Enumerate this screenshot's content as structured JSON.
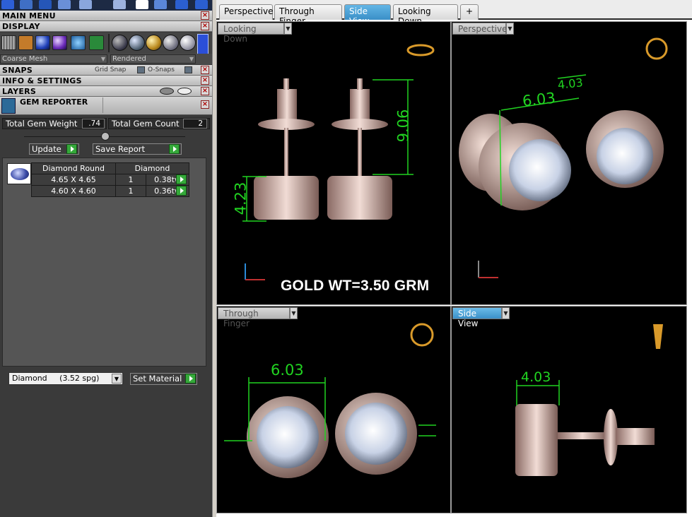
{
  "sidebar": {
    "sections": {
      "main_menu": "MAIN MENU",
      "display": "DISPLAY",
      "snaps": "SNAPS",
      "grid_snap": "Grid Snap",
      "o_snaps": "O-Snaps",
      "info_settings": "INFO & SETTINGS",
      "layers": "LAYERS"
    },
    "display_mode": "Coarse Mesh",
    "render_mode": "Rendered",
    "gem_reporter": {
      "title": "GEM REPORTER",
      "total_weight_label": "Total Gem Weight",
      "total_weight_value": ".74",
      "total_count_label": "Total Gem Count",
      "total_count_value": "2",
      "update_label": "Update",
      "save_report_label": "Save Report",
      "table_headers": [
        "Diamond Round",
        "Diamond"
      ],
      "rows": [
        {
          "size": "4.65 X 4.65",
          "qty": "1",
          "weight": "0.38tw"
        },
        {
          "size": "4.60 X 4.60",
          "qty": "1",
          "weight": "0.36tw"
        }
      ],
      "material": "Diamond     (3.52 spg)",
      "set_material_label": "Set Material"
    }
  },
  "tabs": [
    {
      "label": "Perspective",
      "active": false
    },
    {
      "label": "Through Finger",
      "active": false
    },
    {
      "label": "Side View",
      "active": true
    },
    {
      "label": "Looking Down",
      "active": false
    }
  ],
  "viewports": {
    "top_left": {
      "label": "Looking Down",
      "dim_width": "9.06",
      "dim_height": "4.23",
      "gold_weight": "GOLD WT=3.50 GRM"
    },
    "top_right": {
      "label": "Perspective",
      "dim_diameter": "6.03",
      "dim_side": "4.03"
    },
    "bottom_left": {
      "label": "Through Finger",
      "dim_diameter": "6.03"
    },
    "bottom_right": {
      "label": "Side View",
      "dim_depth": "4.03"
    }
  },
  "colors": {
    "accent": "#3a90c9",
    "dimension": "#21d321",
    "metal": "#d8bcb4"
  }
}
